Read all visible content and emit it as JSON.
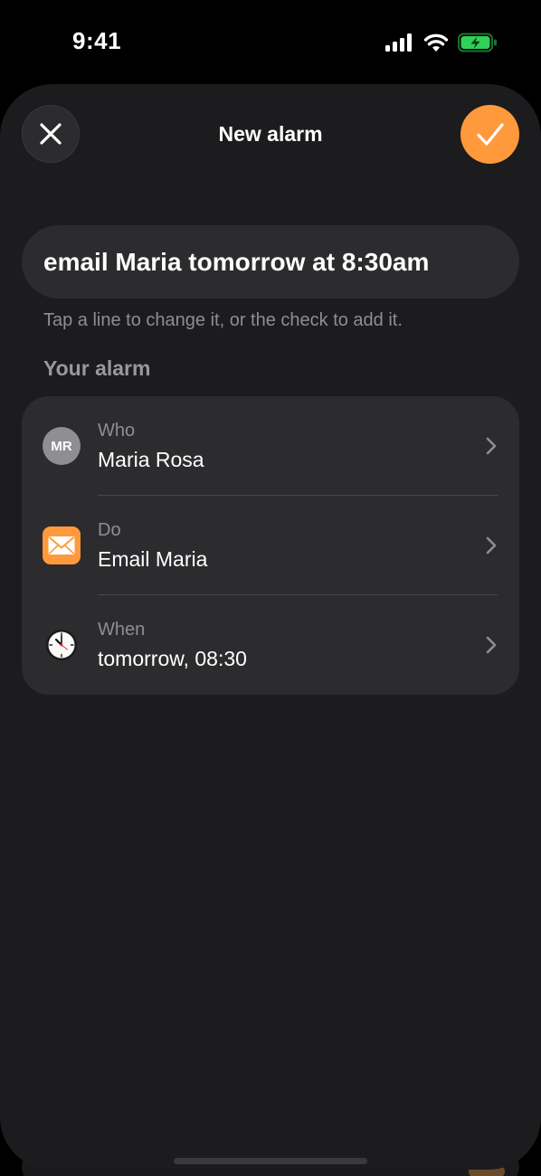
{
  "status_bar": {
    "time": "9:41",
    "icons": [
      "cellular-signal-icon",
      "wifi-icon",
      "battery-charging-icon"
    ],
    "battery_color": "#30d158"
  },
  "sheet": {
    "title": "New alarm",
    "close_icon": "close-icon",
    "confirm_icon": "checkmark-icon",
    "accent_color": "#ff9a3c"
  },
  "query": {
    "value": "email Maria tomorrow at 8:30am"
  },
  "hint": "Tap a line to change it, or the check to add it.",
  "section_title": "Your alarm",
  "rows": [
    {
      "label": "Who",
      "value": "Maria Rosa",
      "avatar_initials": "MR",
      "icon": "avatar-icon"
    },
    {
      "label": "Do",
      "value": "Email Maria",
      "icon": "mail-icon"
    },
    {
      "label": "When",
      "value": "tomorrow, 08:30",
      "icon": "clock-icon"
    }
  ]
}
